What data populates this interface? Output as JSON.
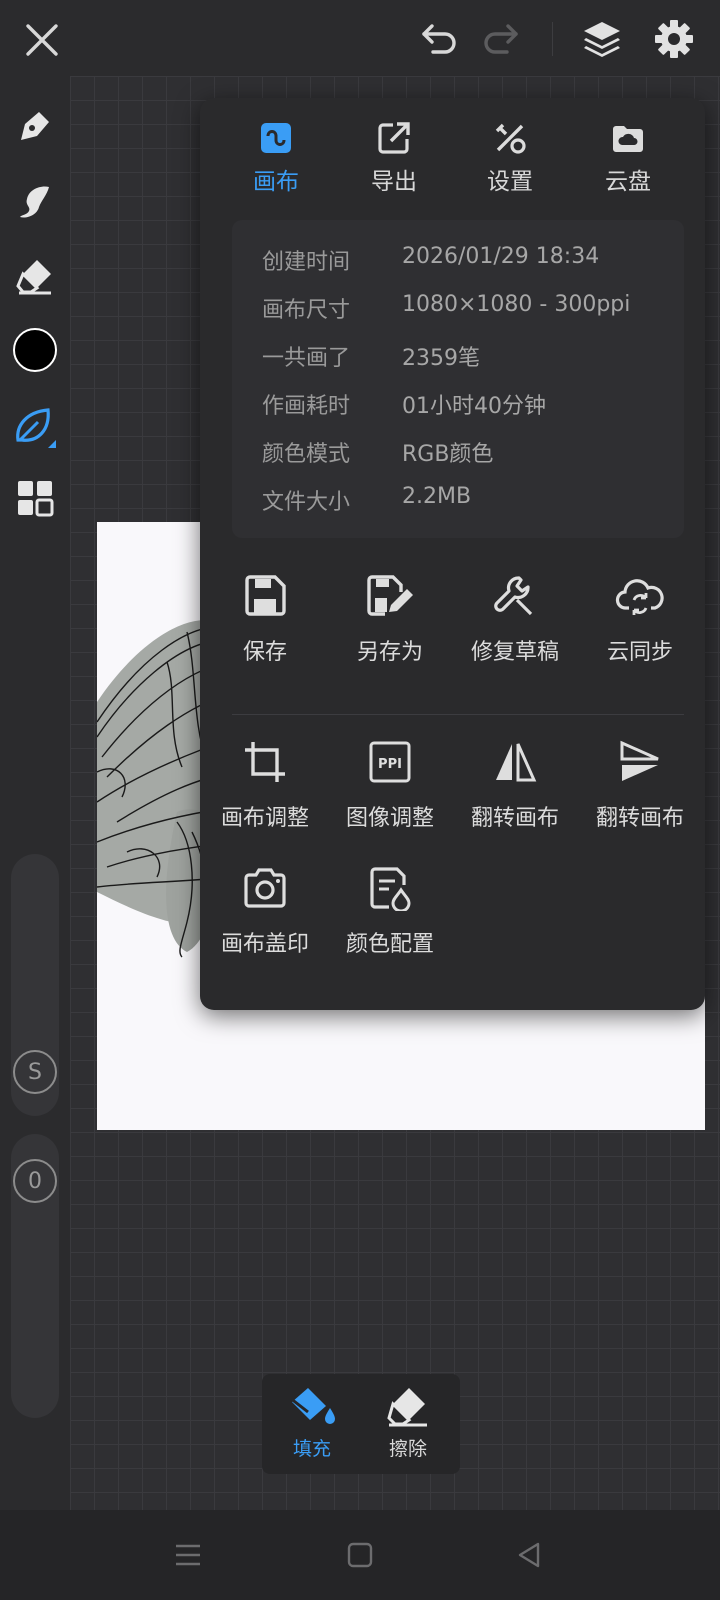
{
  "toolbar": {
    "close": "close-icon",
    "undo": "undo-icon",
    "redo": "redo-icon",
    "layers": "layers-icon",
    "settings": "gear-icon"
  },
  "left_toolbar": {
    "tools": [
      "pen-icon",
      "smudge-icon",
      "eraser-icon",
      "color-swatch",
      "leaf-brush-icon",
      "grid-icon"
    ],
    "current_color": "#000000",
    "size_label": "S",
    "opacity_label": "0"
  },
  "panel": {
    "tabs": [
      {
        "label": "画布",
        "icon": "canvas-icon",
        "active": true
      },
      {
        "label": "导出",
        "icon": "export-icon",
        "active": false
      },
      {
        "label": "设置",
        "icon": "settings-tools-icon",
        "active": false
      },
      {
        "label": "云盘",
        "icon": "cloud-drive-icon",
        "active": false
      }
    ],
    "info": [
      {
        "key": "创建时间",
        "value": "2026/01/29 18:34"
      },
      {
        "key": "画布尺寸",
        "value": "1080×1080 - 300ppi"
      },
      {
        "key": "一共画了",
        "value": "2359笔"
      },
      {
        "key": "作画耗时",
        "value": "01小时40分钟"
      },
      {
        "key": "颜色模式",
        "value": "RGB颜色"
      },
      {
        "key": "文件大小",
        "value": "2.2MB"
      }
    ],
    "actions_top": [
      {
        "label": "保存",
        "icon": "save-icon"
      },
      {
        "label": "另存为",
        "icon": "save-as-icon"
      },
      {
        "label": "修复草稿",
        "icon": "wrench-icon"
      },
      {
        "label": "云同步",
        "icon": "cloud-sync-icon"
      }
    ],
    "actions_bottom": [
      {
        "label": "画布调整",
        "icon": "crop-icon"
      },
      {
        "label": "图像调整",
        "icon": "ppi-icon",
        "badge": "PPI"
      },
      {
        "label": "翻转画布",
        "icon": "flip-horizontal-icon"
      },
      {
        "label": "翻转画布",
        "icon": "flip-vertical-icon"
      },
      {
        "label": "画布盖印",
        "icon": "camera-icon"
      },
      {
        "label": "颜色配置",
        "icon": "color-profile-icon"
      }
    ]
  },
  "fill_bar": {
    "fill_label": "填充",
    "erase_label": "擦除"
  },
  "colors": {
    "accent": "#3a9df5",
    "background": "#2b2b2d",
    "panel": "#2a2a2c"
  }
}
